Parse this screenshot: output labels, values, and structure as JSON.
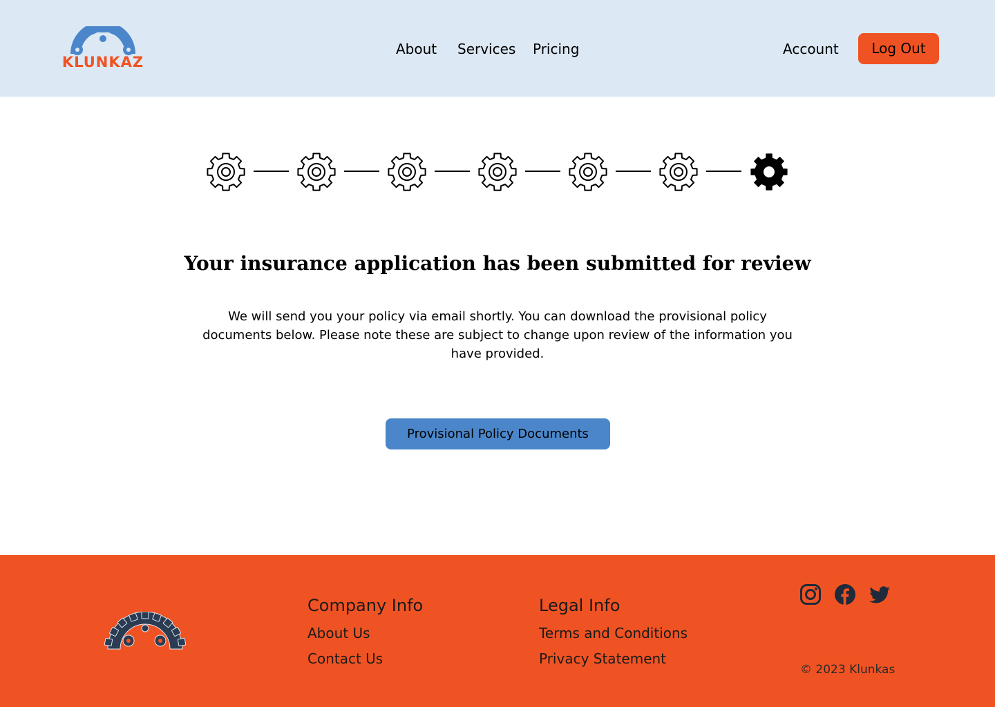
{
  "header": {
    "logo_text": "KLUNKAZ",
    "nav": {
      "about": "About",
      "services": "Services",
      "pricing": "Pricing",
      "account": "Account"
    },
    "logout_label": "Log Out"
  },
  "stepper": {
    "total_steps": 7,
    "current_step": 7,
    "icon": "gear-icon"
  },
  "main": {
    "title": "Your insurance application has been submitted for review",
    "description": "We will send you your policy via email shortly. You can download the provisional policy documents below. Please note these are subject to change upon review of the information you have provided.",
    "button_label": "Provisional Policy Documents"
  },
  "footer": {
    "company": {
      "heading": "Company Info",
      "about": "About Us",
      "contact": "Contact Us"
    },
    "legal": {
      "heading": "Legal Info",
      "terms": "Terms and Conditions",
      "privacy": "Privacy Statement"
    },
    "social": [
      "instagram-icon",
      "facebook-icon",
      "twitter-icon"
    ],
    "copyright": "© 2023 Klunkas"
  },
  "colors": {
    "header_bg": "#dce8f4",
    "accent_orange": "#f05323",
    "accent_blue": "#4a86c9",
    "footer_text": "#1a1a1a",
    "logo_dark": "#2a3b52"
  }
}
